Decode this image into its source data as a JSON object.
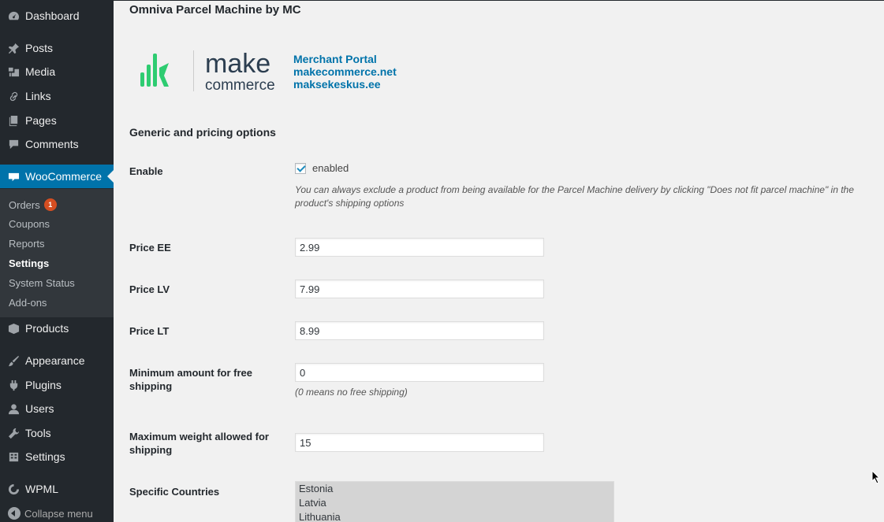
{
  "sidebar": {
    "menu": [
      {
        "label": "Dashboard",
        "icon": "dashboard-icon"
      },
      {
        "label": "Posts",
        "icon": "pin-icon"
      },
      {
        "label": "Media",
        "icon": "media-icon"
      },
      {
        "label": "Links",
        "icon": "link-icon"
      },
      {
        "label": "Pages",
        "icon": "pages-icon"
      },
      {
        "label": "Comments",
        "icon": "comment-icon"
      },
      {
        "label": "WooCommerce",
        "icon": "woocommerce-icon"
      },
      {
        "label": "Products",
        "icon": "products-icon"
      },
      {
        "label": "Appearance",
        "icon": "brush-icon"
      },
      {
        "label": "Plugins",
        "icon": "plugin-icon"
      },
      {
        "label": "Users",
        "icon": "user-icon"
      },
      {
        "label": "Tools",
        "icon": "wrench-icon"
      },
      {
        "label": "Settings",
        "icon": "settings-icon"
      },
      {
        "label": "WPML",
        "icon": "wpml-icon"
      }
    ],
    "submenu": [
      {
        "label": "Orders",
        "badge": "1"
      },
      {
        "label": "Coupons"
      },
      {
        "label": "Reports"
      },
      {
        "label": "Settings"
      },
      {
        "label": "System Status"
      },
      {
        "label": "Add-ons"
      }
    ],
    "collapse": "Collapse menu"
  },
  "page": {
    "title": "Omniva Parcel Machine by MC",
    "logo": {
      "word1": "make",
      "word2": "commerce"
    },
    "links": [
      "Merchant Portal",
      "makecommerce.net",
      "maksekeskus.ee"
    ],
    "section_title": "Generic and pricing options"
  },
  "form": {
    "enable": {
      "label": "Enable",
      "checkbox_label": "enabled",
      "checked": true,
      "description": "You can always exclude a product from being available for the Parcel Machine delivery by clicking \"Does not fit parcel machine\" in the product's shipping options"
    },
    "price_ee": {
      "label": "Price EE",
      "value": "2.99"
    },
    "price_lv": {
      "label": "Price LV",
      "value": "7.99"
    },
    "price_lt": {
      "label": "Price LT",
      "value": "8.99"
    },
    "min_free": {
      "label": "Minimum amount for free shipping",
      "value": "0",
      "description": "(0 means no free shipping)"
    },
    "max_weight": {
      "label": "Maximum weight allowed for shipping",
      "value": "15"
    },
    "countries": {
      "label": "Specific Countries",
      "options": [
        "Estonia",
        "Latvia",
        "Lithuania"
      ]
    }
  },
  "colors": {
    "sidebar_bg": "#23282d",
    "accent": "#0073aa",
    "logo_green": "#2ecc71",
    "logo_dark": "#2c3e50"
  }
}
